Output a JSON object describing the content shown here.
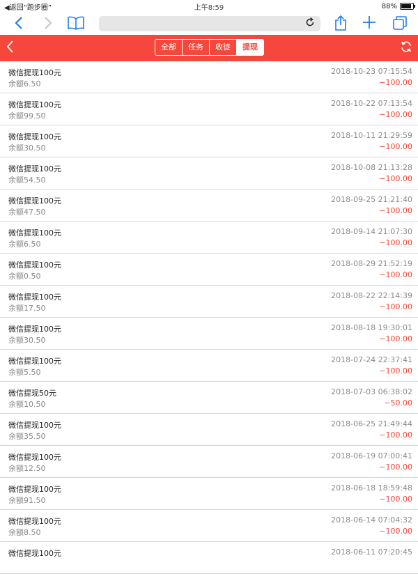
{
  "status_bar": {
    "back_to_app": "◀返回“跑步圈”",
    "time": "上午8:59",
    "battery": "88%",
    "battery_fraction": 0.88
  },
  "browser": {
    "back_icon": "chevron-left-icon",
    "forward_icon": "chevron-right-icon",
    "bookmarks_icon": "book-icon",
    "url_text": "",
    "reload_icon": "reload-icon",
    "share_icon": "share-icon",
    "new_tab_icon": "plus-icon",
    "tabs_icon": "tabs-icon"
  },
  "header": {
    "accent_color": "#f5473c",
    "tabs": [
      {
        "label": "全部",
        "active": false
      },
      {
        "label": "任务",
        "active": false
      },
      {
        "label": "收徒",
        "active": false
      },
      {
        "label": "提现",
        "active": true
      }
    ]
  },
  "records": [
    {
      "title": "微信提现100元",
      "balance": "余额6.50",
      "time": "2018-10-23 07:15:54",
      "amount": "−100.00"
    },
    {
      "title": "微信提现100元",
      "balance": "余额99.50",
      "time": "2018-10-22 07:13:54",
      "amount": "−100.00"
    },
    {
      "title": "微信提现100元",
      "balance": "余额30.50",
      "time": "2018-10-11 21:29:59",
      "amount": "−100.00"
    },
    {
      "title": "微信提现100元",
      "balance": "余额54.50",
      "time": "2018-10-08 21:13:28",
      "amount": "−100.00"
    },
    {
      "title": "微信提现100元",
      "balance": "余额47.50",
      "time": "2018-09-25 21:21:40",
      "amount": "−100.00"
    },
    {
      "title": "微信提现100元",
      "balance": "余额6.50",
      "time": "2018-09-14 21:07:30",
      "amount": "−100.00"
    },
    {
      "title": "微信提现100元",
      "balance": "余额0.50",
      "time": "2018-08-29 21:52:19",
      "amount": "−100.00"
    },
    {
      "title": "微信提现100元",
      "balance": "余额17.50",
      "time": "2018-08-22 22:14:39",
      "amount": "−100.00"
    },
    {
      "title": "微信提现100元",
      "balance": "余额30.50",
      "time": "2018-08-18 19:30:01",
      "amount": "−100.00"
    },
    {
      "title": "微信提现100元",
      "balance": "余额5.50",
      "time": "2018-07-24 22:37:41",
      "amount": "−100.00"
    },
    {
      "title": "微信提现50元",
      "balance": "余额10.50",
      "time": "2018-07-03 06:38:02",
      "amount": "−50.00"
    },
    {
      "title": "微信提现100元",
      "balance": "余额35.50",
      "time": "2018-06-25 21:49:44",
      "amount": "−100.00"
    },
    {
      "title": "微信提现100元",
      "balance": "余额12.50",
      "time": "2018-06-19 07:00:41",
      "amount": "−100.00"
    },
    {
      "title": "微信提现100元",
      "balance": "余额91.50",
      "time": "2018-06-18 18:59:48",
      "amount": "−100.00"
    },
    {
      "title": "微信提现100元",
      "balance": "余额8.50",
      "time": "2018-06-14 07:04:32",
      "amount": "−100.00"
    },
    {
      "title": "微信提现100元",
      "balance": "",
      "time": "2018-06-11 07:20:45",
      "amount": ""
    }
  ]
}
